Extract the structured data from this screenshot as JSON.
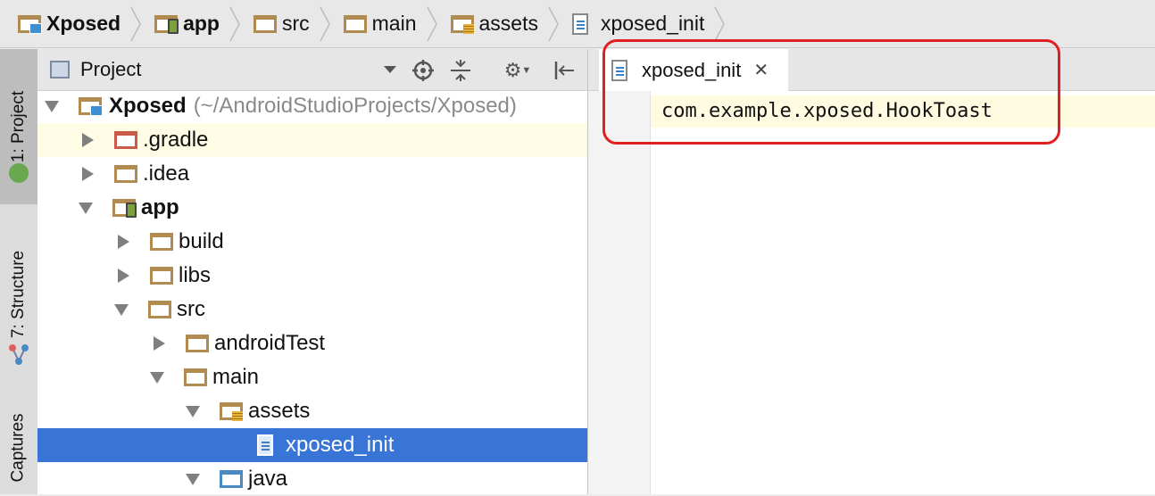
{
  "breadcrumb": [
    {
      "label": "Xposed",
      "icon": "module-folder-icon",
      "bold": true
    },
    {
      "label": "app",
      "icon": "app-module-folder-icon",
      "bold": true
    },
    {
      "label": "src",
      "icon": "folder-icon",
      "bold": false
    },
    {
      "label": "main",
      "icon": "folder-icon",
      "bold": false
    },
    {
      "label": "assets",
      "icon": "assets-folder-icon",
      "bold": false
    },
    {
      "label": "xposed_init",
      "icon": "text-file-icon",
      "bold": false
    }
  ],
  "tool_strip": {
    "project_tab": "1: Project",
    "structure_tab": "7: Structure",
    "captures_tab": "Captures"
  },
  "project_panel": {
    "view_selector": "Project",
    "tree": [
      {
        "label": "Xposed",
        "path": "(~/AndroidStudioProjects/Xposed)",
        "expanded": true,
        "icon": "module-folder-icon"
      },
      {
        "label": ".gradle",
        "expanded": false,
        "icon": "excluded-folder-icon"
      },
      {
        "label": ".idea",
        "expanded": false,
        "icon": "folder-icon"
      },
      {
        "label": "app",
        "expanded": true,
        "icon": "app-module-folder-icon"
      },
      {
        "label": "build",
        "expanded": false,
        "icon": "folder-icon"
      },
      {
        "label": "libs",
        "expanded": false,
        "icon": "folder-icon"
      },
      {
        "label": "src",
        "expanded": true,
        "icon": "folder-icon"
      },
      {
        "label": "androidTest",
        "expanded": false,
        "icon": "folder-icon"
      },
      {
        "label": "main",
        "expanded": true,
        "icon": "folder-icon"
      },
      {
        "label": "assets",
        "expanded": true,
        "icon": "assets-folder-icon"
      },
      {
        "label": "xposed_init",
        "selected": true,
        "icon": "text-file-icon"
      },
      {
        "label": "java",
        "expanded": true,
        "icon": "source-folder-icon"
      }
    ]
  },
  "editor": {
    "tab_label": "xposed_init",
    "code_line_1": "com.example.xposed.HookToast"
  },
  "colors": {
    "selection": "#3875d7",
    "highlight": "#fefce4",
    "annotation": "#e02020"
  }
}
